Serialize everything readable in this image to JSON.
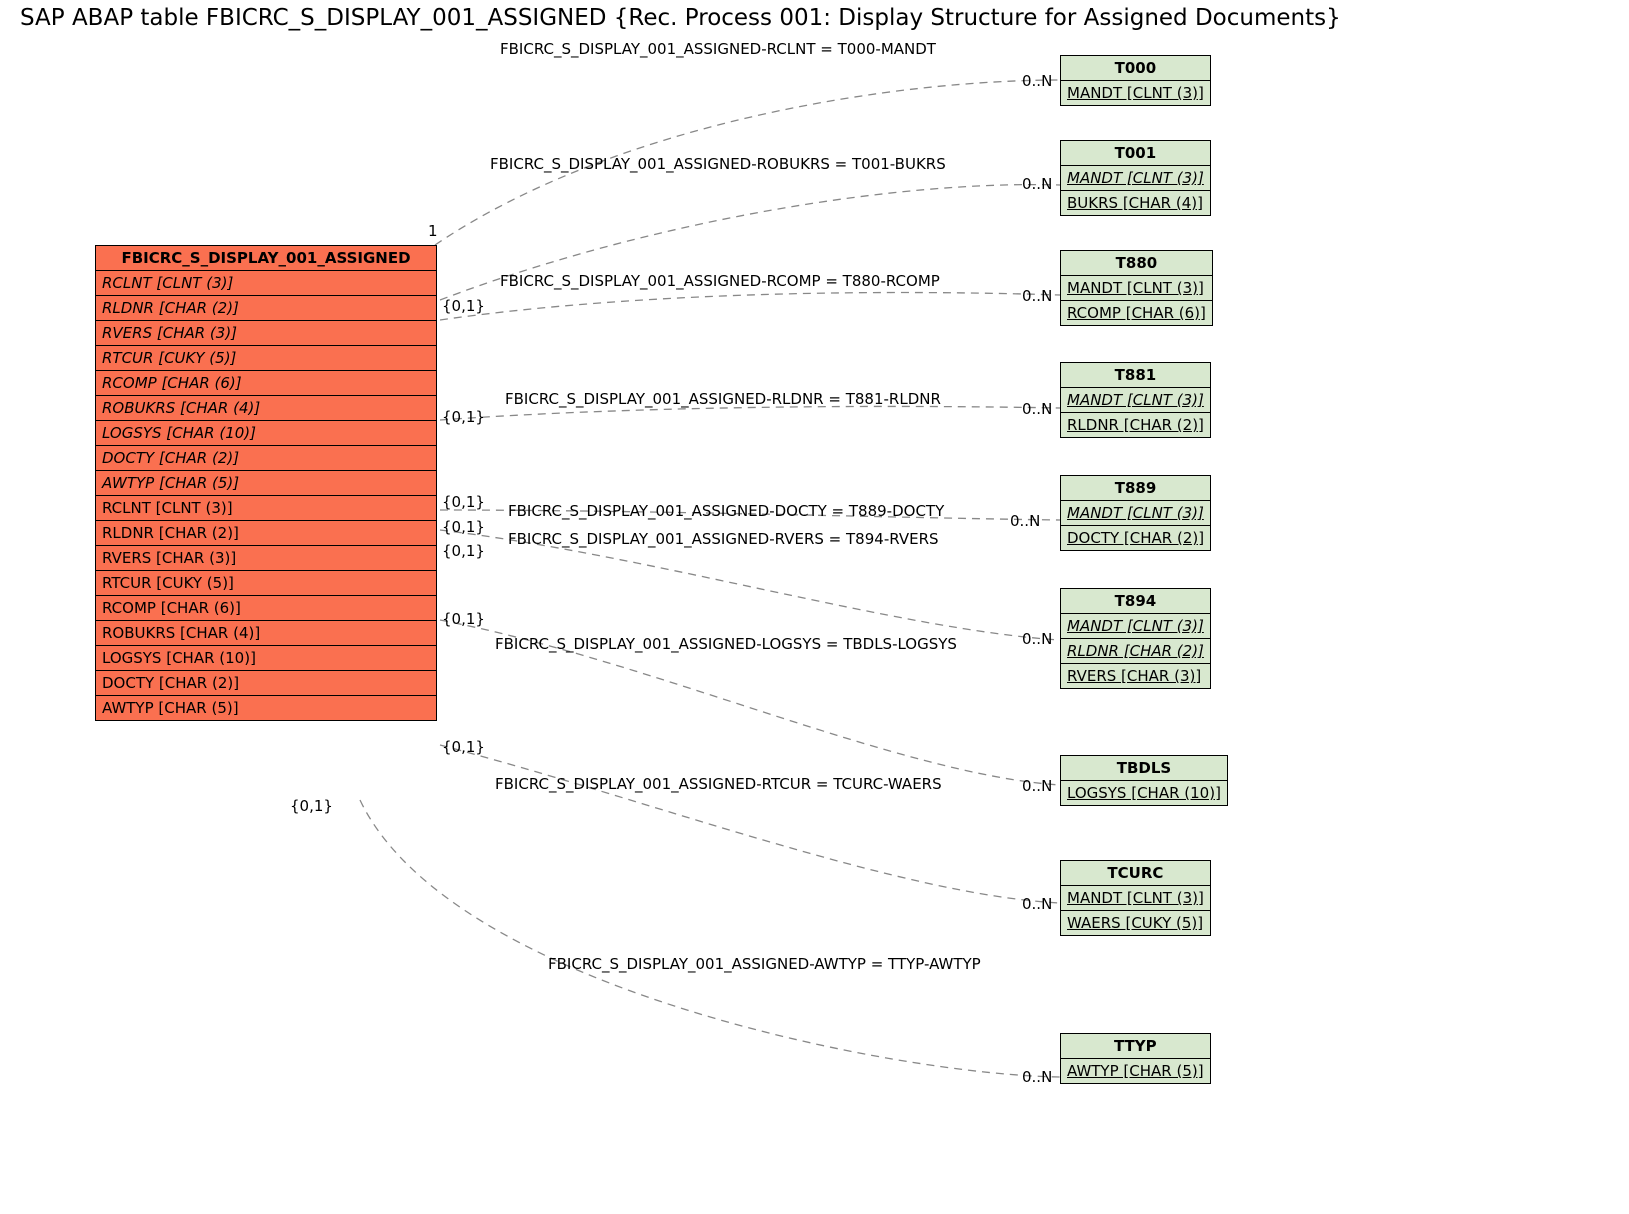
{
  "title": "SAP ABAP table FBICRC_S_DISPLAY_001_ASSIGNED {Rec. Process 001: Display Structure for Assigned Documents}",
  "src": {
    "name": "FBICRC_S_DISPLAY_001_ASSIGNED",
    "fields": [
      {
        "t": "RCLNT [CLNT (3)]",
        "i": true
      },
      {
        "t": "RLDNR [CHAR (2)]",
        "i": true
      },
      {
        "t": "RVERS [CHAR (3)]",
        "i": true
      },
      {
        "t": "RTCUR [CUKY (5)]",
        "i": true
      },
      {
        "t": "RCOMP [CHAR (6)]",
        "i": true
      },
      {
        "t": "ROBUKRS [CHAR (4)]",
        "i": true
      },
      {
        "t": "LOGSYS [CHAR (10)]",
        "i": true
      },
      {
        "t": "DOCTY [CHAR (2)]",
        "i": true
      },
      {
        "t": "AWTYP [CHAR (5)]",
        "i": true
      },
      {
        "t": "RCLNT [CLNT (3)]",
        "i": false
      },
      {
        "t": "RLDNR [CHAR (2)]",
        "i": false
      },
      {
        "t": "RVERS [CHAR (3)]",
        "i": false
      },
      {
        "t": "RTCUR [CUKY (5)]",
        "i": false
      },
      {
        "t": "RCOMP [CHAR (6)]",
        "i": false
      },
      {
        "t": "ROBUKRS [CHAR (4)]",
        "i": false
      },
      {
        "t": "LOGSYS [CHAR (10)]",
        "i": false
      },
      {
        "t": "DOCTY [CHAR (2)]",
        "i": false
      },
      {
        "t": "AWTYP [CHAR (5)]",
        "i": false
      }
    ]
  },
  "targets": [
    {
      "name": "T000",
      "rows": [
        {
          "t": "MANDT [CLNT (3)]",
          "u": true
        }
      ]
    },
    {
      "name": "T001",
      "rows": [
        {
          "t": "MANDT [CLNT (3)]",
          "u": true,
          "i": true
        },
        {
          "t": "BUKRS [CHAR (4)]",
          "u": true
        }
      ]
    },
    {
      "name": "T880",
      "rows": [
        {
          "t": "MANDT [CLNT (3)]",
          "u": true
        },
        {
          "t": "RCOMP [CHAR (6)]",
          "u": true
        }
      ]
    },
    {
      "name": "T881",
      "rows": [
        {
          "t": "MANDT [CLNT (3)]",
          "u": true,
          "i": true
        },
        {
          "t": "RLDNR [CHAR (2)]",
          "u": true
        }
      ]
    },
    {
      "name": "T889",
      "rows": [
        {
          "t": "MANDT [CLNT (3)]",
          "u": true,
          "i": true
        },
        {
          "t": "DOCTY [CHAR (2)]",
          "u": true
        }
      ]
    },
    {
      "name": "T894",
      "rows": [
        {
          "t": "MANDT [CLNT (3)]",
          "u": true,
          "i": true
        },
        {
          "t": "RLDNR [CHAR (2)]",
          "u": true,
          "i": true
        },
        {
          "t": "RVERS [CHAR (3)]",
          "u": true
        }
      ]
    },
    {
      "name": "TBDLS",
      "rows": [
        {
          "t": "LOGSYS [CHAR (10)]",
          "u": true
        }
      ]
    },
    {
      "name": "TCURC",
      "rows": [
        {
          "t": "MANDT [CLNT (3)]",
          "u": true
        },
        {
          "t": "WAERS [CUKY (5)]",
          "u": true
        }
      ]
    },
    {
      "name": "TTYP",
      "rows": [
        {
          "t": "AWTYP [CHAR (5)]",
          "u": true
        }
      ]
    }
  ],
  "rels": [
    {
      "t": "FBICRC_S_DISPLAY_001_ASSIGNED-RCLNT = T000-MANDT"
    },
    {
      "t": "FBICRC_S_DISPLAY_001_ASSIGNED-ROBUKRS = T001-BUKRS"
    },
    {
      "t": "FBICRC_S_DISPLAY_001_ASSIGNED-RCOMP = T880-RCOMP"
    },
    {
      "t": "FBICRC_S_DISPLAY_001_ASSIGNED-RLDNR = T881-RLDNR"
    },
    {
      "t": "FBICRC_S_DISPLAY_001_ASSIGNED-DOCTY = T889-DOCTY"
    },
    {
      "t": "FBICRC_S_DISPLAY_001_ASSIGNED-RVERS = T894-RVERS"
    },
    {
      "t": "FBICRC_S_DISPLAY_001_ASSIGNED-LOGSYS = TBDLS-LOGSYS"
    },
    {
      "t": "FBICRC_S_DISPLAY_001_ASSIGNED-RTCUR = TCURC-WAERS"
    },
    {
      "t": "FBICRC_S_DISPLAY_001_ASSIGNED-AWTYP = TTYP-AWTYP"
    }
  ],
  "card": {
    "one": "1",
    "zn": "0..N",
    "zo": "{0,1}"
  }
}
